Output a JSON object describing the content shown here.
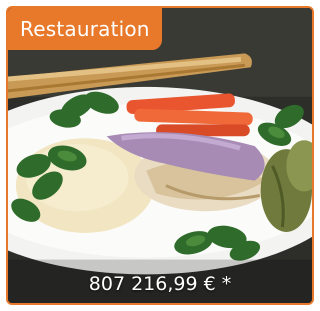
{
  "product": {
    "category_label": "Restauration",
    "price_text": "807 216,99 € *",
    "image_subject": "plated-fish-with-rice-and-vegetables"
  },
  "colors": {
    "accent": "#e8792b",
    "price_text": "#ffffff"
  }
}
